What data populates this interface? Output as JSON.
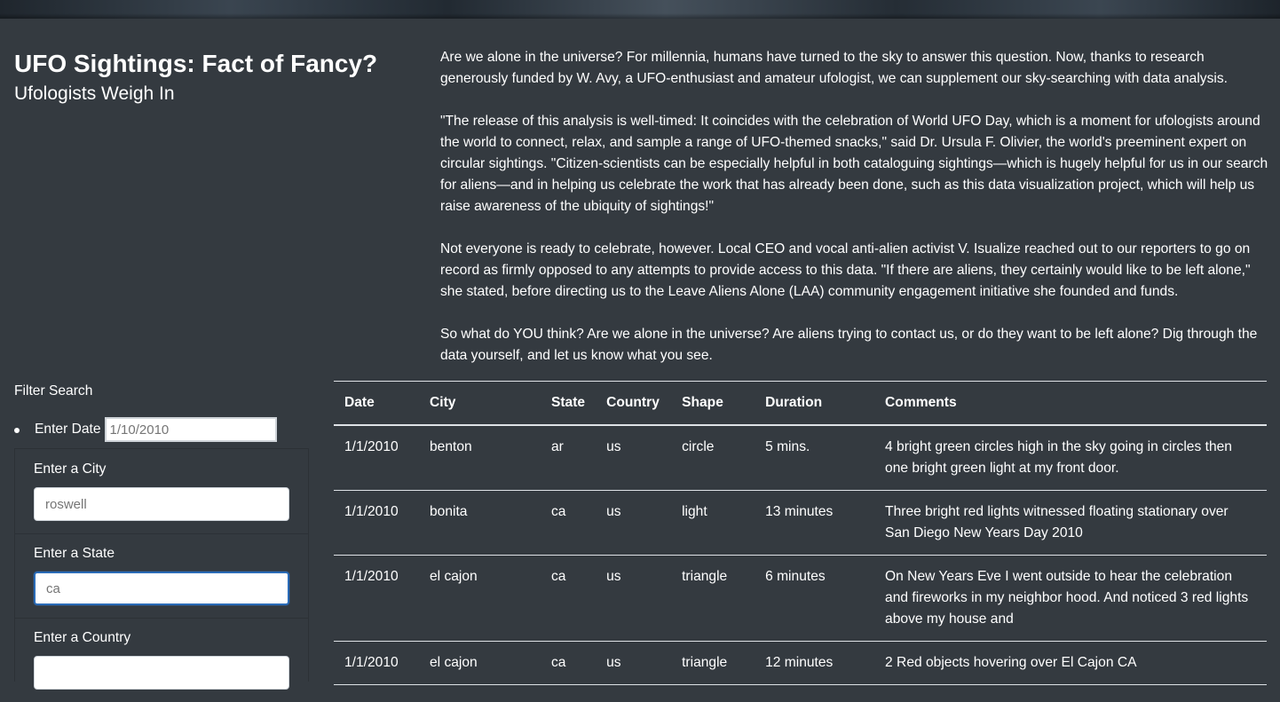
{
  "header": {
    "title": "UFO Sightings: Fact of Fancy?",
    "subtitle": "Ufologists Weigh In"
  },
  "article": {
    "paragraphs": [
      "Are we alone in the universe? For millennia, humans have turned to the sky to answer this question. Now, thanks to research generously funded by W. Avy, a UFO-enthusiast and amateur ufologist, we can supplement our sky-searching with data analysis.",
      "\"The release of this analysis is well-timed: It coincides with the celebration of World UFO Day, which is a moment for ufologists around the world to connect, relax, and sample a range of UFO-themed snacks,\" said Dr. Ursula F. Olivier, the world's preeminent expert on circular sightings. \"Citizen-scientists can be especially helpful in both cataloguing sightings—which is hugely helpful for us in our search for aliens—and in helping us celebrate the work that has already been done, such as this data visualization project, which will help us raise awareness of the ubiquity of sightings!\"",
      "Not everyone is ready to celebrate, however. Local CEO and vocal anti-alien activist V. Isualize reached out to our reporters to go on record as firmly opposed to any attempts to provide access to this data. \"If there are aliens, they certainly would like to be left alone,\" she stated, before directing us to the Leave Aliens Alone (LAA) community engagement initiative she founded and funds.",
      "So what do YOU think? Are we alone in the universe? Are aliens trying to contact us, or do they want to be left alone? Dig through the data yourself, and let us know what you see."
    ]
  },
  "filters": {
    "title": "Filter Search",
    "date_label": "Enter Date",
    "date_placeholder": "1/10/2010",
    "city_label": "Enter a City",
    "city_placeholder": "roswell",
    "state_label": "Enter a State",
    "state_value": "ca",
    "country_label": "Enter a Country"
  },
  "table": {
    "headers": [
      "Date",
      "City",
      "State",
      "Country",
      "Shape",
      "Duration",
      "Comments"
    ],
    "rows": [
      [
        "1/1/2010",
        "benton",
        "ar",
        "us",
        "circle",
        "5 mins.",
        "4 bright green circles high in the sky going in circles then one bright green light at my front door."
      ],
      [
        "1/1/2010",
        "bonita",
        "ca",
        "us",
        "light",
        "13 minutes",
        "Three bright red lights witnessed floating stationary over San Diego New Years Day 2010"
      ],
      [
        "1/1/2010",
        "el cajon",
        "ca",
        "us",
        "triangle",
        "6 minutes",
        "On New Years Eve I went outside to hear the celebration and fireworks in my neighbor hood. And noticed 3 red lights above my house and"
      ],
      [
        "1/1/2010",
        "el cajon",
        "ca",
        "us",
        "triangle",
        "12 minutes",
        "2 Red objects hovering over El Cajon CA"
      ]
    ]
  },
  "colors": {
    "background": "#343a40",
    "text": "#ffffff",
    "focus_border": "#2a6bb7"
  }
}
